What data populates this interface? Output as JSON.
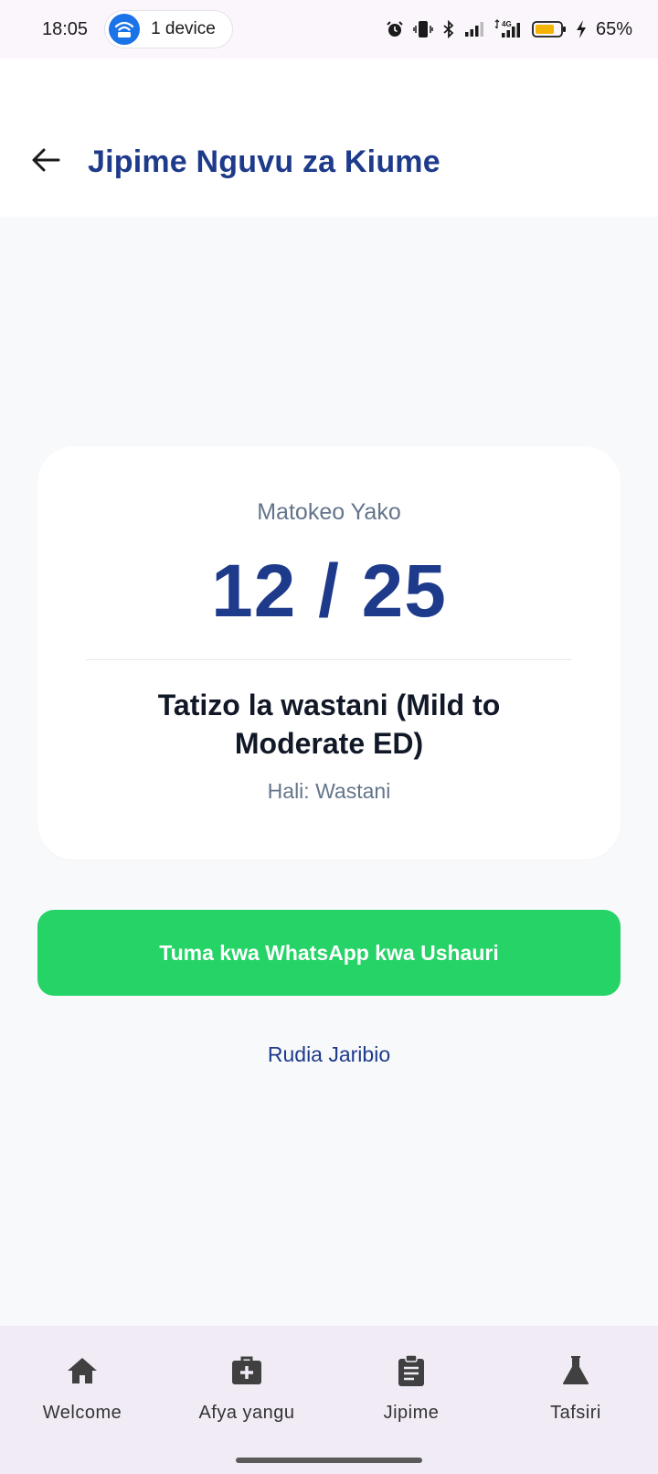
{
  "status_bar": {
    "time": "18:05",
    "hotspot_label": "1 device",
    "battery_percent": "65%",
    "network_type": "4G"
  },
  "app_bar": {
    "title": "Jipime Nguvu za Kiume"
  },
  "result": {
    "label": "Matokeo Yako",
    "score": "12 / 25",
    "diagnosis": "Tatizo la wastani (Mild to Moderate ED)",
    "status": "Hali: Wastani"
  },
  "actions": {
    "whatsapp_label": "Tuma kwa WhatsApp kwa Ushauri",
    "whatsapp_color": "#25d366",
    "retry_label": "Rudia Jaribio"
  },
  "bottom_nav": {
    "items": [
      {
        "label": "Welcome",
        "icon": "home-icon"
      },
      {
        "label": "Afya yangu",
        "icon": "medical-bag-icon"
      },
      {
        "label": "Jipime",
        "icon": "clipboard-icon"
      },
      {
        "label": "Tafsiri",
        "icon": "flask-icon"
      }
    ]
  },
  "colors": {
    "primary": "#1e3a8a",
    "background": "#f8f9fb",
    "nav_background": "#f1ebf5"
  }
}
